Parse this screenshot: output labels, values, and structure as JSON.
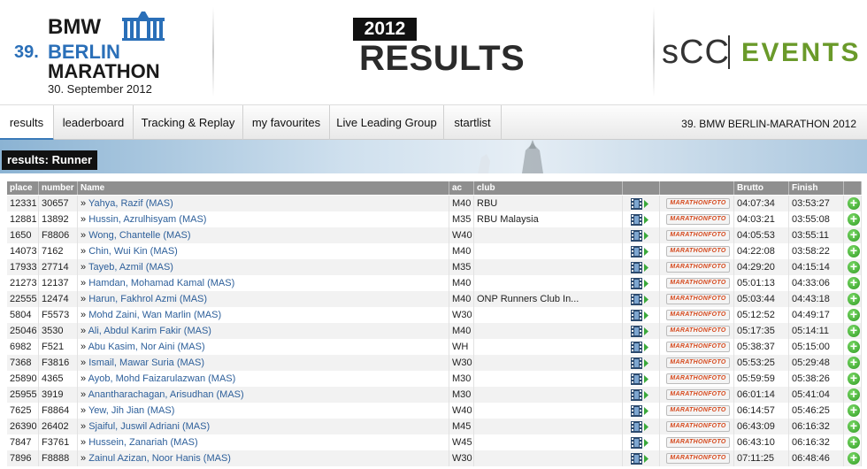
{
  "logo": {
    "brand": "BMW",
    "edition": "39.",
    "city": "BERLIN",
    "event": "MARATHON",
    "date": "30. September 2012"
  },
  "results_header": {
    "year": "2012",
    "title": "RESULTS"
  },
  "sponsor": {
    "scc": "sCC",
    "events": "EVENTS"
  },
  "nav": {
    "tabs": [
      "results",
      "leaderboard",
      "Tracking & Replay",
      "my favourites",
      "Live Leading Group",
      "startlist"
    ],
    "active": "results",
    "event_title": "39. BMW BERLIN-MARATHON 2012"
  },
  "section_label": "results: Runner",
  "table": {
    "headers": [
      "place",
      "number",
      "Name",
      "ac",
      "club",
      "",
      "",
      "Brutto",
      "Finish",
      ""
    ],
    "foto_badge": "MARATHONFOTO",
    "rows": [
      {
        "place": "12331",
        "number": "30657",
        "name": "Yahya, Razif (MAS)",
        "ac": "M40",
        "club": "RBU",
        "brutto": "04:07:34",
        "finish": "03:53:27"
      },
      {
        "place": "12881",
        "number": "13892",
        "name": "Hussin, Azrulhisyam (MAS)",
        "ac": "M35",
        "club": "RBU Malaysia",
        "brutto": "04:03:21",
        "finish": "03:55:08"
      },
      {
        "place": "1650",
        "number": "F8806",
        "name": "Wong, Chantelle (MAS)",
        "ac": "W40",
        "club": "",
        "brutto": "04:05:53",
        "finish": "03:55:11"
      },
      {
        "place": "14073",
        "number": "7162",
        "name": "Chin, Wui Kin (MAS)",
        "ac": "M40",
        "club": "",
        "brutto": "04:22:08",
        "finish": "03:58:22"
      },
      {
        "place": "17933",
        "number": "27714",
        "name": "Tayeb, Azmil (MAS)",
        "ac": "M35",
        "club": "",
        "brutto": "04:29:20",
        "finish": "04:15:14"
      },
      {
        "place": "21273",
        "number": "12137",
        "name": "Hamdan, Mohamad Kamal (MAS)",
        "ac": "M40",
        "club": "",
        "brutto": "05:01:13",
        "finish": "04:33:06"
      },
      {
        "place": "22555",
        "number": "12474",
        "name": "Harun, Fakhrol Azmi (MAS)",
        "ac": "M40",
        "club": "ONP Runners Club In...",
        "brutto": "05:03:44",
        "finish": "04:43:18"
      },
      {
        "place": "5804",
        "number": "F5573",
        "name": "Mohd Zaini, Wan Marlin (MAS)",
        "ac": "W30",
        "club": "",
        "brutto": "05:12:52",
        "finish": "04:49:17"
      },
      {
        "place": "25046",
        "number": "3530",
        "name": "Ali, Abdul Karim Fakir (MAS)",
        "ac": "M40",
        "club": "",
        "brutto": "05:17:35",
        "finish": "05:14:11"
      },
      {
        "place": "6982",
        "number": "F521",
        "name": "Abu Kasim, Nor Aini (MAS)",
        "ac": "WH",
        "club": "",
        "brutto": "05:38:37",
        "finish": "05:15:00"
      },
      {
        "place": "7368",
        "number": "F3816",
        "name": "Ismail, Mawar Suria (MAS)",
        "ac": "W30",
        "club": "",
        "brutto": "05:53:25",
        "finish": "05:29:48"
      },
      {
        "place": "25890",
        "number": "4365",
        "name": "Ayob, Mohd Faizarulazwan (MAS)",
        "ac": "M30",
        "club": "",
        "brutto": "05:59:59",
        "finish": "05:38:26"
      },
      {
        "place": "25955",
        "number": "3919",
        "name": "Anantharachagan, Arisudhan (MAS)",
        "ac": "M30",
        "club": "",
        "brutto": "06:01:14",
        "finish": "05:41:04"
      },
      {
        "place": "7625",
        "number": "F8864",
        "name": "Yew, Jih Jian (MAS)",
        "ac": "W40",
        "club": "",
        "brutto": "06:14:57",
        "finish": "05:46:25"
      },
      {
        "place": "26390",
        "number": "26402",
        "name": "Sjaiful, Juswil Adriani (MAS)",
        "ac": "M45",
        "club": "",
        "brutto": "06:43:09",
        "finish": "06:16:32"
      },
      {
        "place": "7847",
        "number": "F3761",
        "name": "Hussein, Zanariah (MAS)",
        "ac": "W45",
        "club": "",
        "brutto": "06:43:10",
        "finish": "06:16:32"
      },
      {
        "place": "7896",
        "number": "F8888",
        "name": "Zainul Azizan, Noor Hanis (MAS)",
        "ac": "W30",
        "club": "",
        "brutto": "07:11:25",
        "finish": "06:48:46"
      }
    ]
  },
  "colors": {
    "link": "#2d5f9a",
    "accent": "#3a7ab8",
    "events_green": "#6a9a2a",
    "plus_green": "#2e9a22"
  }
}
